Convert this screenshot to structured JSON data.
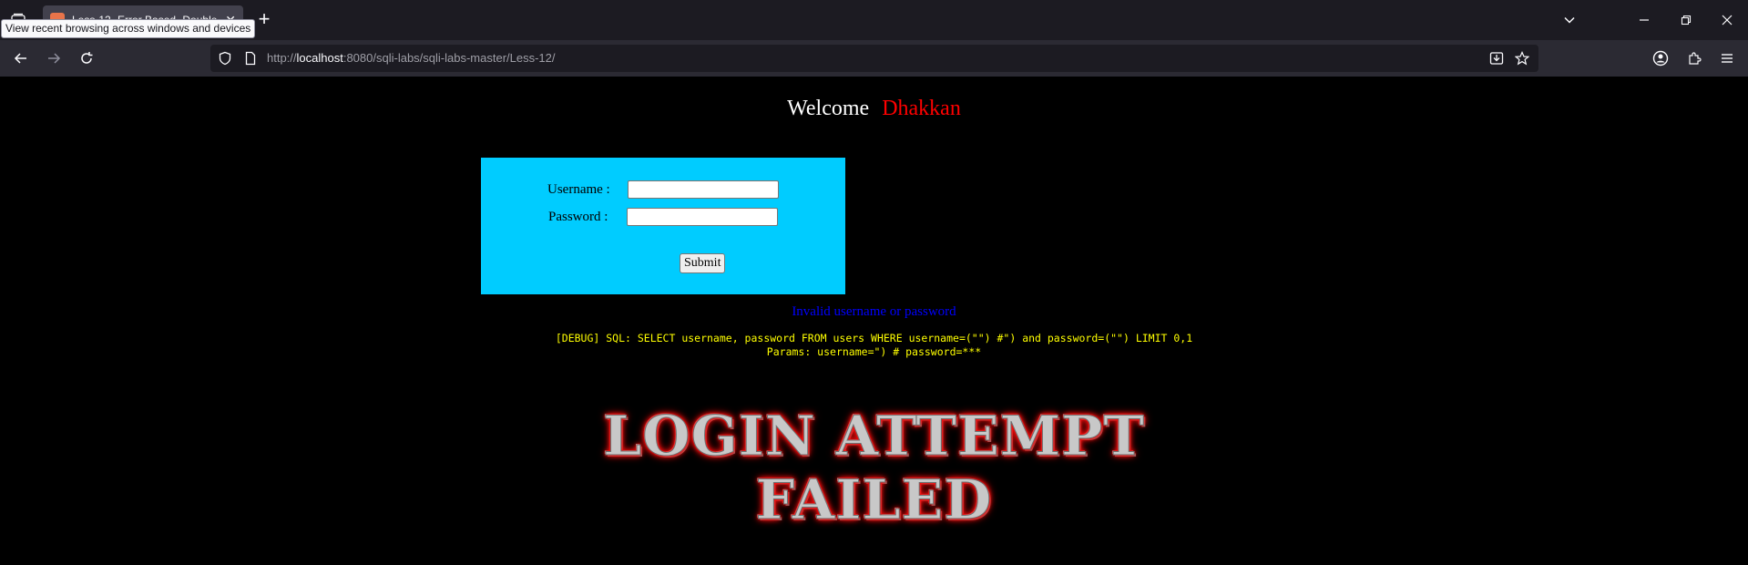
{
  "browser": {
    "tab_title": "Less-12- Error Based- Double",
    "tab_close": "✕",
    "new_tab": "+",
    "tooltip": "View recent browsing across windows and devices",
    "url_host": "localhost",
    "url_rest": ":8080/sqli-labs/sqli-labs-master/Less-12/",
    "url_prefix": "http://"
  },
  "page": {
    "welcome": "Welcome",
    "user_name": "Dhakkan",
    "form": {
      "username_label": "Username :",
      "password_label": "Password :",
      "username_value": "",
      "password_value": "",
      "submit_label": "Submit"
    },
    "error_message": "Invalid username or password",
    "debug_sql": "[DEBUG] SQL: SELECT username, password FROM users WHERE username=(\"\") #\") and password=(\"\") LIMIT 0,1",
    "debug_params": "Params: username=\") # password=***",
    "banner_line1": "LOGIN ATTEMPT",
    "banner_line2": "FAILED"
  },
  "colors": {
    "form_bg": "#00ccff",
    "welcome_name": "#ff0000",
    "error": "#0000ff",
    "debug": "#ffff00"
  }
}
